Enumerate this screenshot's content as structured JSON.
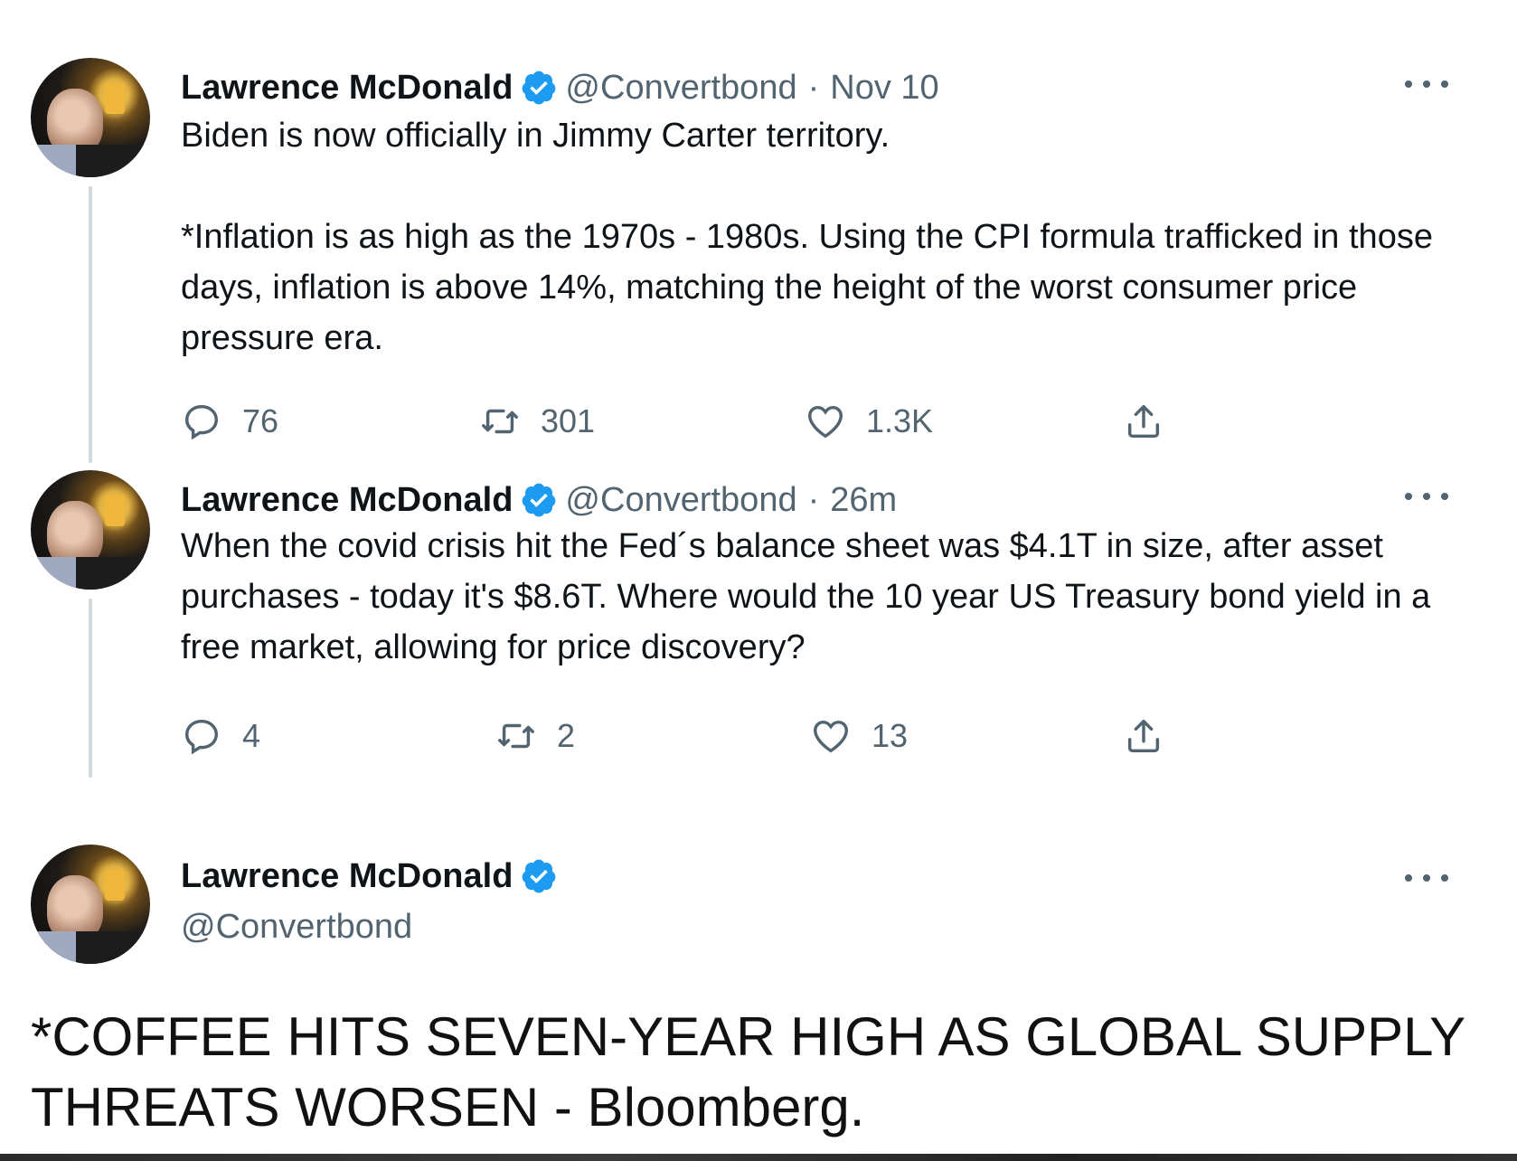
{
  "tweets": [
    {
      "author_name": "Lawrence McDonald",
      "handle": "@Convertbond",
      "separator": "·",
      "time": "Nov 10",
      "text_lines": [
        "Biden is now officially in Jimmy Carter territory.",
        "*Inflation is as high as the 1970s - 1980s. Using the CPI formula trafficked in those days, inflation is above 14%, matching the height of the worst consumer price pressure era."
      ],
      "replies": "76",
      "retweets": "301",
      "likes": "1.3K"
    },
    {
      "author_name": "Lawrence McDonald",
      "handle": "@Convertbond",
      "separator": "·",
      "time": "26m",
      "text_lines": [
        "When the covid crisis hit the Fed´s balance sheet was $4.1T in size, after asset purchases - today it's $8.6T. Where would the 10 year US Treasury bond yield in a free market, allowing for price discovery?"
      ],
      "replies": "4",
      "retweets": "2",
      "likes": "13"
    },
    {
      "author_name": "Lawrence McDonald",
      "handle": "@Convertbond"
    }
  ],
  "caption": "*COFFEE HITS SEVEN-YEAR HIGH AS GLOBAL SUPPLY THREATS WORSEN - Bloomberg.",
  "colors": {
    "text": "#0f1419",
    "secondary": "#536471",
    "verified": "#1d9bf0",
    "thread_line": "#cfd9de"
  },
  "icons": [
    "reply-icon",
    "retweet-icon",
    "like-icon",
    "share-icon",
    "verified-badge-icon",
    "more-options-icon"
  ]
}
